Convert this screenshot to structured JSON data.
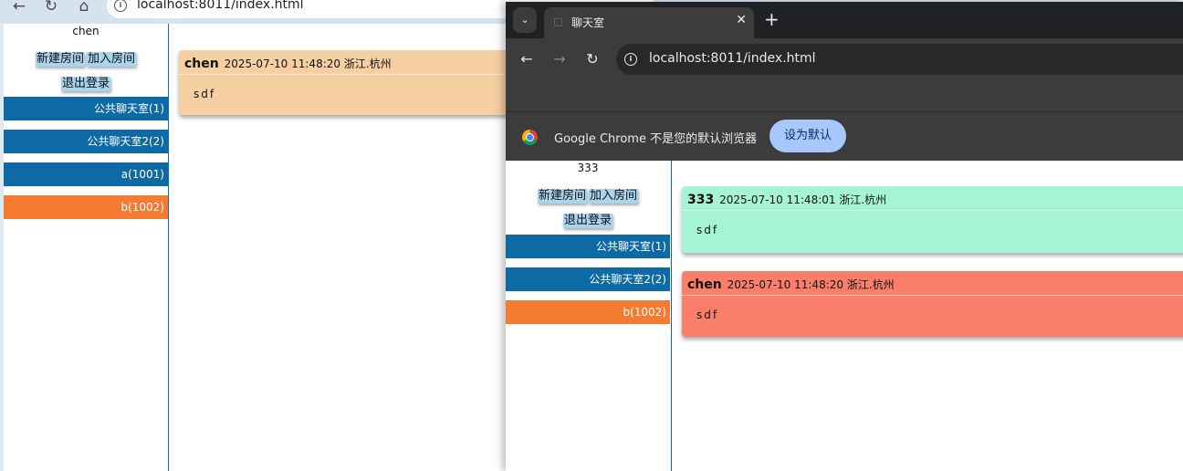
{
  "back_window": {
    "url": "localhost:8011/index.html",
    "nav_icons": [
      "back-arrow-icon",
      "reload-icon",
      "home-icon",
      "info-icon"
    ],
    "username": "chen",
    "buttons": {
      "new_room": "新建房间",
      "join_room": "加入房间",
      "logout": "退出登录"
    },
    "rooms": [
      {
        "label": "公共聊天室(1)",
        "active": false
      },
      {
        "label": "公共聊天室2(2)",
        "active": false
      },
      {
        "label": "a(1001)",
        "active": false
      },
      {
        "label": "b(1002)",
        "active": true
      }
    ],
    "messages": [
      {
        "user": "chen",
        "meta": "2025-07-10 11:48:20 浙江.杭州",
        "text": "sdf",
        "color": "#f6cfa3"
      }
    ]
  },
  "front_window": {
    "tab_title": "聊天室",
    "url": "localhost:8011/index.html",
    "infobar_text": "Google Chrome 不是您的默认浏览器",
    "set_default_label": "设为默认",
    "username": "333",
    "buttons": {
      "new_room": "新建房间",
      "join_room": "加入房间",
      "logout": "退出登录"
    },
    "rooms": [
      {
        "label": "公共聊天室(1)",
        "active": false
      },
      {
        "label": "公共聊天室2(2)",
        "active": false
      },
      {
        "label": "b(1002)",
        "active": true
      }
    ],
    "messages": [
      {
        "user": "333",
        "meta": "2025-07-10 11:48:01 浙江.杭州",
        "text": "sdf",
        "color": "#a6f4d6"
      },
      {
        "user": "chen",
        "meta": "2025-07-10 11:48:20 浙江.杭州",
        "text": "sdf",
        "color": "#fa7f6b"
      }
    ]
  },
  "colors": {
    "room_blue": "#0e6aa4",
    "room_active": "#f57a32",
    "button_bg": "#a8d4ec"
  }
}
